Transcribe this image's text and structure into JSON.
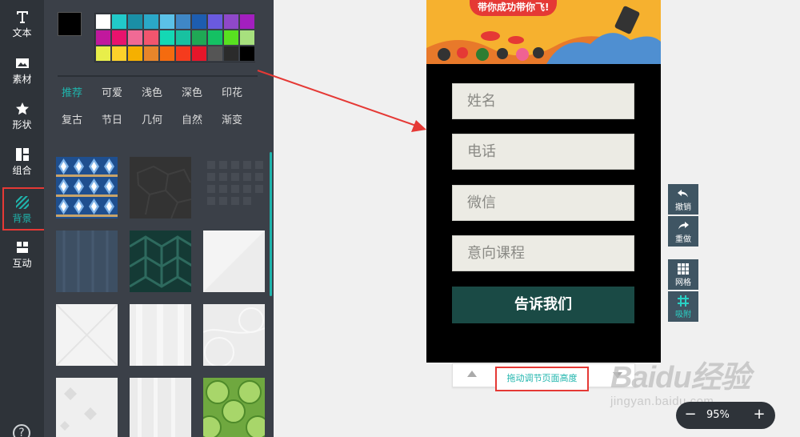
{
  "rail": {
    "items": [
      {
        "label": "文本",
        "icon": "text-icon"
      },
      {
        "label": "素材",
        "icon": "image-icon"
      },
      {
        "label": "形状",
        "icon": "star-icon"
      },
      {
        "label": "组合",
        "icon": "layout-icon"
      },
      {
        "label": "背景",
        "icon": "background-icon",
        "active": true
      },
      {
        "label": "互动",
        "icon": "interact-icon"
      }
    ],
    "help": "?"
  },
  "panel": {
    "current_color": "#000000",
    "palette": [
      "#ffffff",
      "#21c9c9",
      "#1a8fa6",
      "#2aa8c8",
      "#5bc1e8",
      "#3f87c6",
      "#1d5db0",
      "#6a5adf",
      "#8f48c9",
      "#a31fbf",
      "#c1189d",
      "#e8136d",
      "#f06a95",
      "#f2556e",
      "#14d8b4",
      "#18c1a0",
      "#1fa855",
      "#14c163",
      "#58e020",
      "#a7e07e",
      "#e8ee4a",
      "#fdd22b",
      "#f5b000",
      "#e8852a",
      "#f56b0f",
      "#f53b1d",
      "#e6162a",
      "#555555",
      "#2b2b2b",
      "#000000"
    ],
    "categories": [
      "推荐",
      "可爱",
      "浅色",
      "深色",
      "印花",
      "复古",
      "节日",
      "几何",
      "自然",
      "渐变"
    ],
    "active_category": "推荐"
  },
  "phone": {
    "banner_text": "带你成功带你飞!",
    "fields": [
      "姓名",
      "电话",
      "微信",
      "意向课程"
    ],
    "submit_label": "告诉我们"
  },
  "resize_bar": {
    "label": "拖动调节页面高度"
  },
  "tools": [
    {
      "label": "撤销",
      "icon": "undo-icon"
    },
    {
      "label": "重做",
      "icon": "redo-icon"
    },
    {
      "label": "网格",
      "icon": "grid-icon"
    },
    {
      "label": "吸附",
      "icon": "snap-icon"
    }
  ],
  "zoom": {
    "minus": "−",
    "value": "95%",
    "plus": "+"
  },
  "watermark": {
    "main": "Baidu经验",
    "sub": "jingyan.baidu.com"
  },
  "colors": {
    "accent": "#1fb5ad",
    "highlight": "#e53935",
    "submit_bg": "#1a4a45"
  }
}
